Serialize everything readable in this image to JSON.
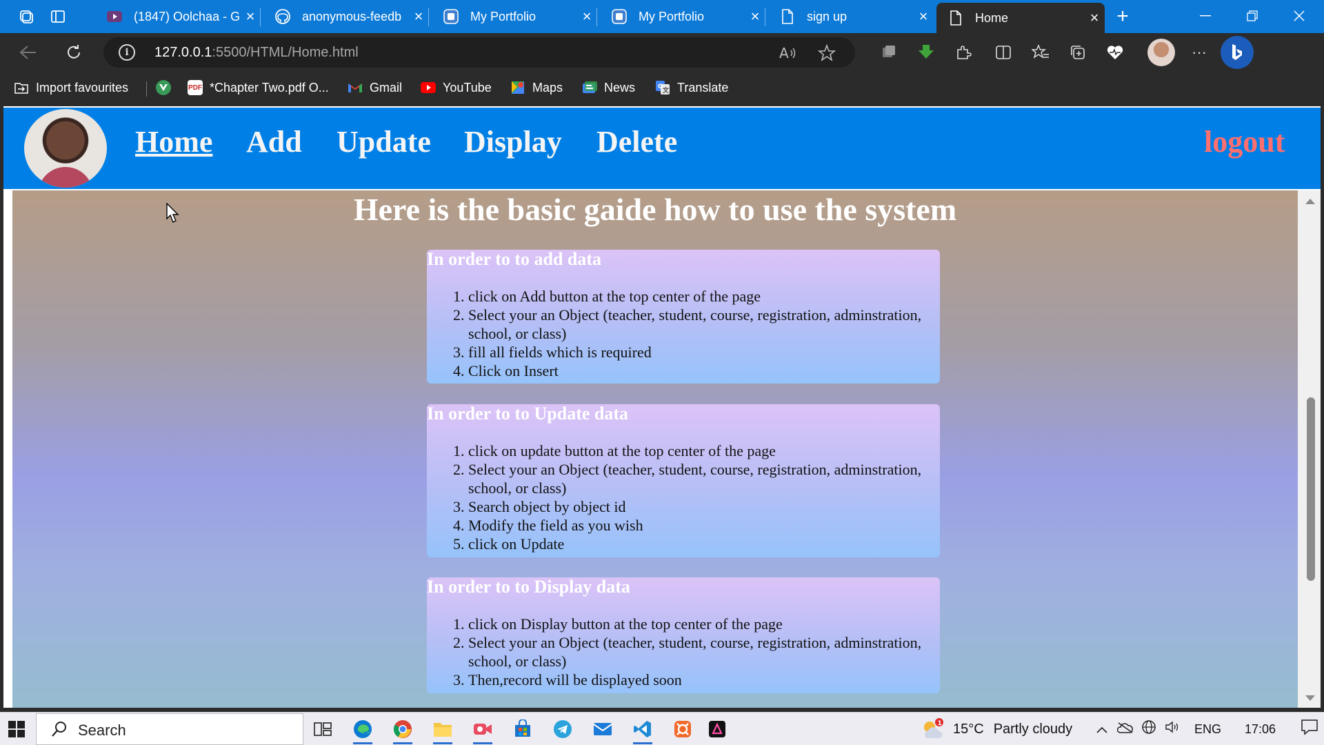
{
  "browser": {
    "tabs": [
      {
        "title": "(1847) Oolchaa - G",
        "favicon": "youtube-icon"
      },
      {
        "title": "anonymous-feedb",
        "favicon": "github-icon"
      },
      {
        "title": "My Portfolio",
        "favicon": "portfolio-icon"
      },
      {
        "title": "My Portfolio",
        "favicon": "portfolio-icon"
      },
      {
        "title": "sign up",
        "favicon": "page-icon"
      },
      {
        "title": "Home",
        "favicon": "page-icon",
        "active": true
      }
    ],
    "address": {
      "host": "127.0.0.1",
      "rest": ":5500/HTML/Home.html"
    },
    "favourites": [
      {
        "label": "Import favourites",
        "icon": "import-icon"
      },
      {
        "label": "",
        "icon": "vuejs-icon"
      },
      {
        "label": "*Chapter Two.pdf O...",
        "icon": "pdf-icon"
      },
      {
        "label": "Gmail",
        "icon": "gmail-icon"
      },
      {
        "label": "YouTube",
        "icon": "youtube-icon"
      },
      {
        "label": "Maps",
        "icon": "maps-icon"
      },
      {
        "label": "News",
        "icon": "news-icon"
      },
      {
        "label": "Translate",
        "icon": "translate-icon"
      }
    ]
  },
  "site": {
    "nav": [
      "Home",
      "Add",
      "Update",
      "Display",
      "Delete"
    ],
    "logout": "logout",
    "guide_title": "Here is the basic gaide how to use the system",
    "sections": [
      {
        "heading": "In order to to add data",
        "steps": [
          "click on Add button at the top center of the page",
          "Select your an Object (teacher, student, course, registration, adminstration, school, or class)",
          "fill all fields which is required",
          "Click on Insert"
        ]
      },
      {
        "heading": "In order to to Update data",
        "steps": [
          "click on update button at the top center of the page",
          "Select your an Object (teacher, student, course, registration, adminstration, school, or class)",
          "Search object by object id",
          "Modify the field as you wish",
          "click on Update"
        ]
      },
      {
        "heading": "In order to to Display data",
        "steps": [
          "click on Display button at the top center of the page",
          "Select your an Object (teacher, student, course, registration, adminstration, school, or class)",
          "Then,record will be displayed soon"
        ]
      }
    ],
    "colors": {
      "nav": "#0080e6",
      "logout": "#ff6f6f",
      "card_top": "#dcc3f7",
      "card_bottom": "#96c3fb"
    }
  },
  "taskbar": {
    "search_placeholder": "Search",
    "weather": {
      "temp": "15°C",
      "desc": "Partly cloudy",
      "badge": "1"
    },
    "language": "ENG",
    "time": "17:06"
  }
}
